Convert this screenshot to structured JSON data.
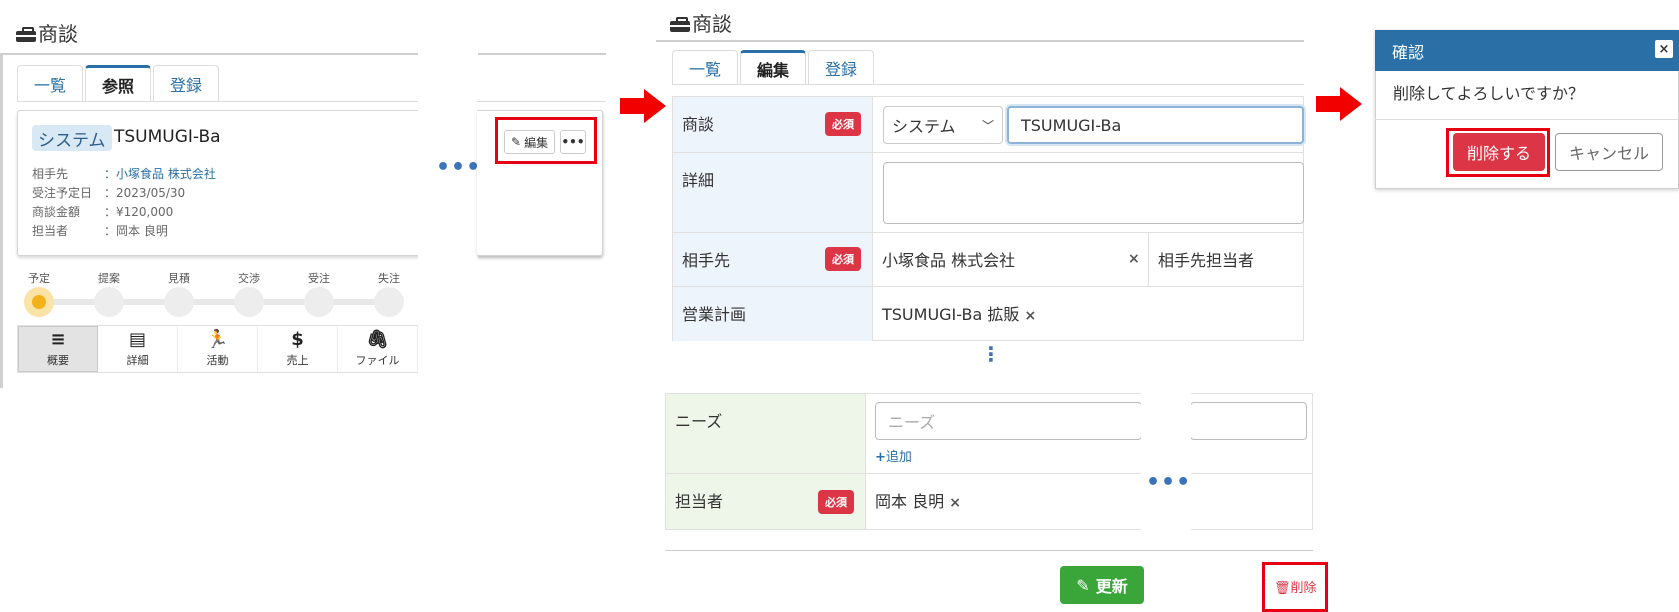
{
  "panel1": {
    "title": "商談",
    "tabs": [
      {
        "label": "一覧"
      },
      {
        "label": "参照"
      },
      {
        "label": "登録"
      }
    ],
    "card": {
      "category": "システム",
      "name": "TSUMUGI-Ba",
      "rows": [
        {
          "label": "相手先",
          "value": "：小塚食品 株式会社"
        },
        {
          "label": "受注予定日",
          "value": "：2023/05/30"
        },
        {
          "label": "商談金額",
          "value": "：¥120,000"
        },
        {
          "label": "担当者",
          "value": "：岡本 良明"
        }
      ]
    },
    "stages": [
      {
        "label": "予定"
      },
      {
        "label": "提案"
      },
      {
        "label": "見積"
      },
      {
        "label": "交渉"
      },
      {
        "label": "受注"
      },
      {
        "label": "失注"
      }
    ],
    "icon_bar": [
      {
        "label": "概要",
        "icon": "≡"
      },
      {
        "label": "詳細",
        "icon": "▤"
      },
      {
        "label": "活動",
        "icon": "🏃"
      },
      {
        "label": "売上",
        "icon": "$"
      },
      {
        "label": "ファイル",
        "icon": "🖇"
      }
    ],
    "ellipsis": "•••",
    "edit_label": "編集",
    "edit_icon": "✎",
    "more_label": "•••"
  },
  "panel2": {
    "title": "商談",
    "tabs": [
      {
        "label": "一覧"
      },
      {
        "label": "編集"
      },
      {
        "label": "登録"
      }
    ],
    "required": "必須",
    "fields": {
      "deal": {
        "label": "商談",
        "select": "システム",
        "value": "TSUMUGI-Ba"
      },
      "detail": {
        "label": "詳細"
      },
      "client": {
        "label": "相手先",
        "value": "小塚食品 株式会社",
        "contact_label": "相手先担当者"
      },
      "plan": {
        "label": "営業計画",
        "value": "TSUMUGI-Ba 拡販"
      },
      "needs": {
        "label": "ニーズ",
        "placeholder": "ニーズ",
        "add": "追加"
      },
      "owner": {
        "label": "担当者",
        "value": "岡本 良明"
      }
    },
    "remove": "×",
    "vdots": "⋮",
    "ellipsis": "•••",
    "update_label": "更新",
    "delete_label": "削除"
  },
  "panel3": {
    "title": "確認",
    "close": "×",
    "message": "削除してよろしいですか？",
    "confirm_label": "削除する",
    "cancel_label": "キャンセル"
  }
}
